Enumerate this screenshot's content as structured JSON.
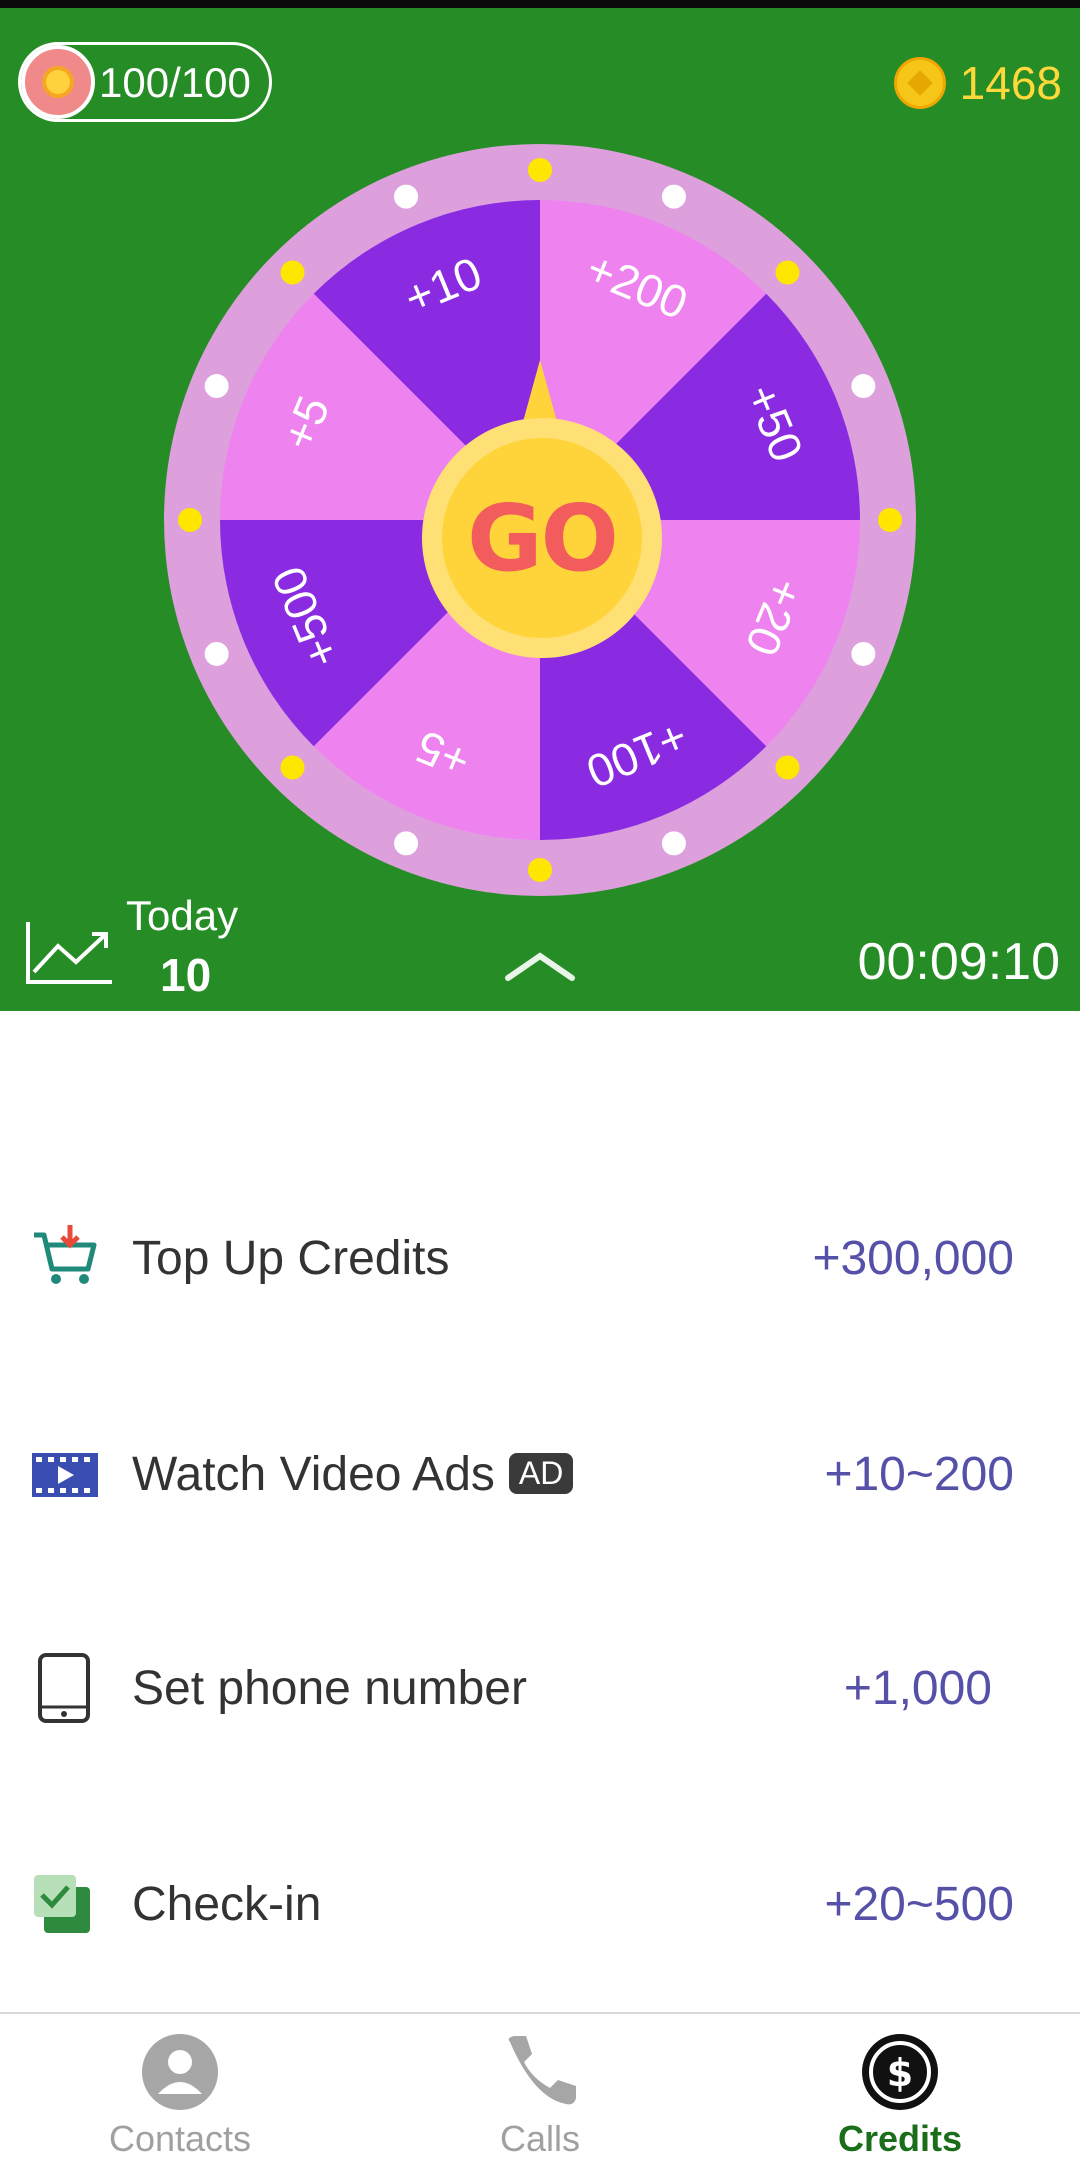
{
  "header": {
    "energy": "100/100",
    "coins": "1468"
  },
  "wheel": {
    "go_label": "GO",
    "segments": [
      "+10",
      "+200",
      "+50",
      "+20",
      "+100",
      "+5",
      "+500",
      "+5"
    ],
    "colors": {
      "dark": "#8a2be2",
      "light": "#ee82ee",
      "rim": "#dda0dd"
    }
  },
  "stats": {
    "today_label": "Today",
    "today_value": "10",
    "countdown": "00:09:10"
  },
  "tasks": [
    {
      "label": "Top Up Credits",
      "reward": "+300,000",
      "icon": "cart-icon"
    },
    {
      "label": "Watch Video Ads",
      "badge": "AD",
      "reward": "+10~200",
      "icon": "video-icon"
    },
    {
      "label": "Set phone number",
      "reward": "+1,000",
      "icon": "phone-icon"
    },
    {
      "label": "Check-in",
      "reward": "+20~500",
      "icon": "checkin-icon"
    }
  ],
  "nav": {
    "items": [
      {
        "label": "Contacts",
        "icon": "person-icon"
      },
      {
        "label": "Calls",
        "icon": "phone-handset-icon"
      },
      {
        "label": "Credits",
        "icon": "dollar-icon",
        "active": true
      }
    ]
  },
  "colors": {
    "panel": "#268c26",
    "reward_text": "#5550a8",
    "active_nav": "#1a6e1a"
  }
}
